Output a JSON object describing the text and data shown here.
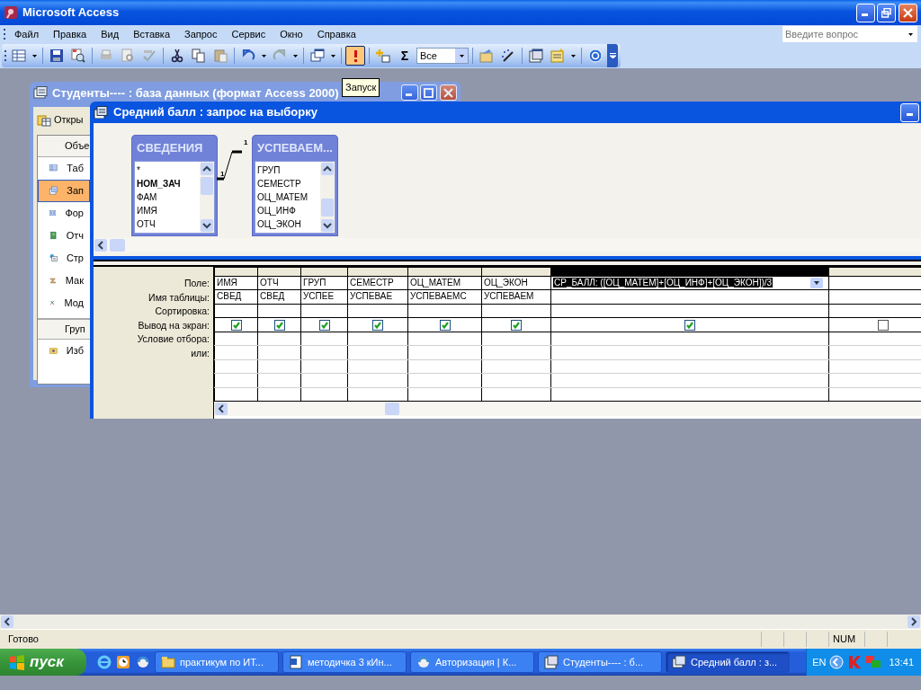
{
  "app_window": {
    "title": "Microsoft Access"
  },
  "menu": [
    "Файл",
    "Правка",
    "Вид",
    "Вставка",
    "Запрос",
    "Сервис",
    "Окно",
    "Справка"
  ],
  "help_search": {
    "placeholder": "Введите вопрос"
  },
  "toolbar": {
    "run_button_hovered": true,
    "totals_label": "Σ",
    "top_values": "Все",
    "tooltip": "Запуск"
  },
  "db_window": {
    "title": "Студенты---- : база данных (формат Access 2000)",
    "open_button": "Откры",
    "objects_header": "Объе",
    "objects": [
      {
        "label": "Таб",
        "selected": false
      },
      {
        "label": "Зап",
        "selected": true
      },
      {
        "label": "Фор",
        "selected": false
      },
      {
        "label": "Отч",
        "selected": false
      },
      {
        "label": "Стр",
        "selected": false
      },
      {
        "label": "Мак",
        "selected": false
      },
      {
        "label": "Мод",
        "selected": false
      }
    ],
    "groups_header": "Груп",
    "groups": [
      {
        "label": "Изб",
        "selected": false
      }
    ]
  },
  "query_window": {
    "title": "Средний балл : запрос на выборку",
    "tables": [
      {
        "name": "СВЕДЕНИЯ",
        "fields": [
          {
            "name": "*",
            "key": false
          },
          {
            "name": "НОМ_ЗАЧ",
            "key": true
          },
          {
            "name": "ФАМ",
            "key": false
          },
          {
            "name": "ИМЯ",
            "key": false
          },
          {
            "name": "ОТЧ",
            "key": false
          }
        ]
      },
      {
        "name": "УСПЕВАЕМ...",
        "fields": [
          {
            "name": "ГРУП",
            "key": false
          },
          {
            "name": "СЕМЕСТР",
            "key": false
          },
          {
            "name": "ОЦ_МАТЕМ",
            "key": false
          },
          {
            "name": "ОЦ_ИНФ",
            "key": false
          },
          {
            "name": "ОЦ_ЭКОН",
            "key": false
          }
        ]
      }
    ],
    "relationship": {
      "left_label": "1",
      "right_label": "1"
    },
    "row_labels": [
      "Поле:",
      "Имя таблицы:",
      "Сортировка:",
      "Вывод на экран:",
      "Условие отбора:",
      "или:"
    ],
    "columns": [
      {
        "field": "ИМЯ",
        "table": "СВЕД",
        "show": true,
        "selected": false
      },
      {
        "field": "ОТЧ",
        "table": "СВЕД",
        "show": true,
        "selected": false
      },
      {
        "field": "ГРУП",
        "table": "УСПЕЕ",
        "show": true,
        "selected": false
      },
      {
        "field": "СЕМЕСТР",
        "table": "УСПЕВАЕ",
        "show": true,
        "selected": false
      },
      {
        "field": "ОЦ_МАТЕМ",
        "table": "УСПЕВАЕМС",
        "show": true,
        "selected": false
      },
      {
        "field": "ОЦ_ЭКОН",
        "table": "УСПЕВАЕМ",
        "show": true,
        "selected": false
      },
      {
        "field": "СР_БАЛЛ: ([ОЦ_МАТЕМ]+[ОЦ_ИНФ]+[ОЦ_ЭКОН])/3",
        "show": true,
        "selected": true
      },
      {
        "show": false,
        "selected": false
      }
    ]
  },
  "status_bar": {
    "text": "Готово",
    "num_lock": "NUM"
  },
  "taskbar": {
    "start": "пуск",
    "tasks": [
      {
        "label": "практикум по ИТ...",
        "selected": false
      },
      {
        "label": "методичка 3 кИн...",
        "selected": false
      },
      {
        "label": "Авторизация | К...",
        "selected": false
      },
      {
        "label": "Студенты---- : б...",
        "selected": false
      },
      {
        "label": "Средний балл : з...",
        "selected": true
      }
    ],
    "language": "EN",
    "clock": "13:41"
  }
}
